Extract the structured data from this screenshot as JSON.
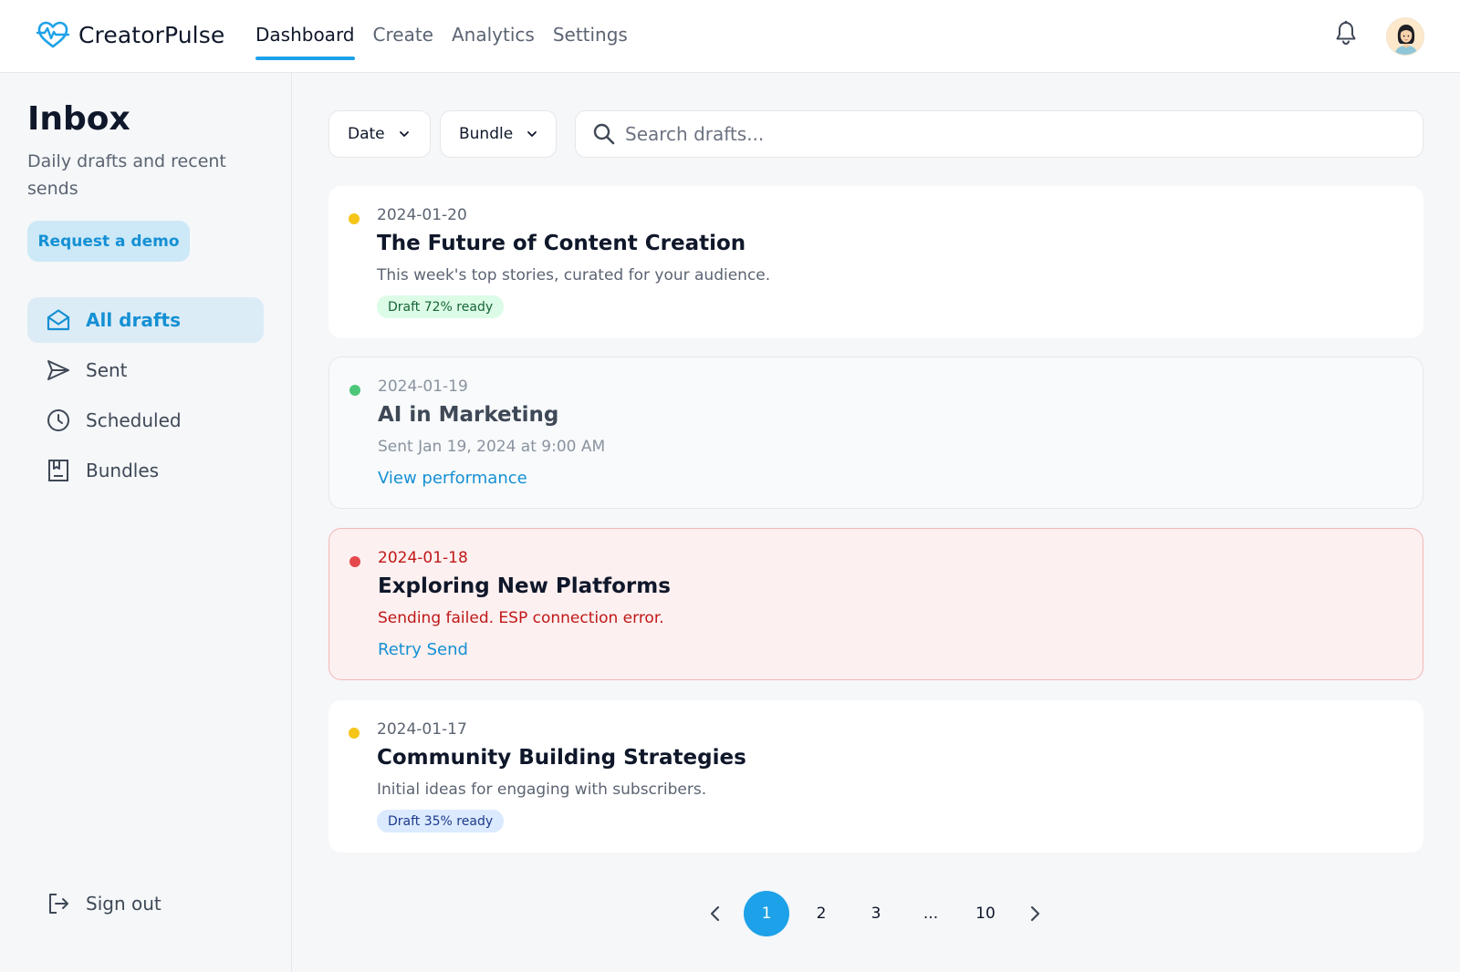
{
  "app": {
    "name": "CreatorPulse"
  },
  "nav": {
    "items": [
      {
        "label": "Dashboard",
        "active": true
      },
      {
        "label": "Create",
        "active": false
      },
      {
        "label": "Analytics",
        "active": false
      },
      {
        "label": "Settings",
        "active": false
      }
    ]
  },
  "header": {
    "bell_icon": "bell-icon",
    "avatar_icon": "user-avatar"
  },
  "sidebar": {
    "title": "Inbox",
    "subtitle": "Daily drafts and recent sends",
    "demo_button": "Request a demo",
    "items": [
      {
        "label": "All drafts",
        "icon": "envelope-open-icon",
        "active": true
      },
      {
        "label": "Sent",
        "icon": "send-icon",
        "active": false
      },
      {
        "label": "Scheduled",
        "icon": "clock-icon",
        "active": false
      },
      {
        "label": "Bundles",
        "icon": "bundle-icon",
        "active": false
      }
    ],
    "signout": {
      "label": "Sign out",
      "icon": "sign-out-icon"
    }
  },
  "toolbar": {
    "date_filter": "Date",
    "bundle_filter": "Bundle",
    "search_placeholder": "Search drafts..."
  },
  "drafts": [
    {
      "date": "2024-01-20",
      "title": "The Future of Content Creation",
      "description": "This week's top stories, curated for your audience.",
      "badge": "Draft 72% ready",
      "status": "draft",
      "status_color": "#f5c518"
    },
    {
      "date": "2024-01-19",
      "title": "AI in Marketing",
      "description": "Sent Jan 19, 2024 at 9:00 AM",
      "link": "View performance",
      "status": "sent",
      "status_color": "#4cc77a"
    },
    {
      "date": "2024-01-18",
      "title": "Exploring New Platforms",
      "description": "Sending failed. ESP connection error.",
      "link": "Retry Send",
      "status": "error",
      "status_color": "#e5484d"
    },
    {
      "date": "2024-01-17",
      "title": "Community Building Strategies",
      "description": "Initial ideas for engaging with subscribers.",
      "badge": "Draft 35% ready",
      "status": "draft",
      "status_color": "#f5c518"
    }
  ],
  "pagination": {
    "pages": [
      "1",
      "2",
      "3",
      "...",
      "10"
    ],
    "current": "1"
  },
  "colors": {
    "accent": "#1da1e8",
    "badge_green_bg": "#dcfce7",
    "badge_green_text": "#166534",
    "badge_blue_bg": "#dbeafe",
    "badge_blue_text": "#1e3a8a"
  }
}
